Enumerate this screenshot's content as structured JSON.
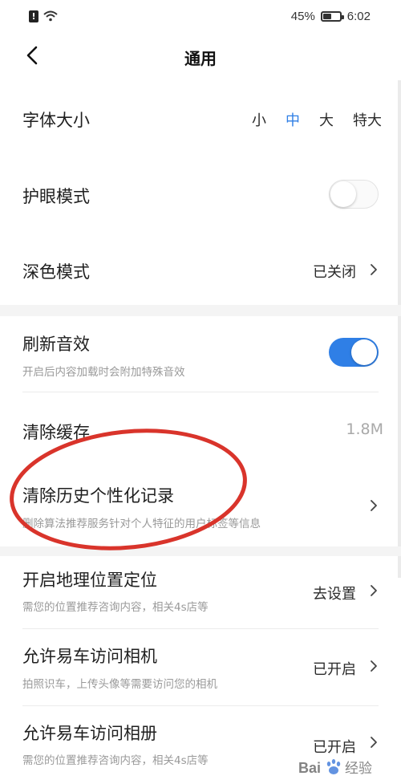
{
  "status_bar": {
    "battery": "45%",
    "battery_level": 0.45,
    "time": "6:02",
    "icons": [
      "alert-icon",
      "wifi-icon",
      "battery-icon"
    ]
  },
  "header": {
    "title": "通用",
    "back_icon": "chevron-left-icon"
  },
  "settings": {
    "font_size": {
      "label": "字体大小",
      "options": [
        "小",
        "中",
        "大",
        "特大"
      ],
      "selected": "中"
    },
    "eye_care": {
      "label": "护眼模式",
      "enabled": false
    },
    "dark_mode": {
      "label": "深色模式",
      "value": "已关闭"
    },
    "refresh_sound": {
      "label": "刷新音效",
      "description": "开启后内容加载时会附加特殊音效",
      "enabled": true
    },
    "clear_cache": {
      "label": "清除缓存",
      "value": "1.8M"
    },
    "clear_history": {
      "label": "清除历史个性化记录",
      "description": "删除算法推荐服务针对个人特征的用户标签等信息"
    },
    "location": {
      "label": "开启地理位置定位",
      "description": "需您的位置推荐咨询内容，相关4s店等",
      "value": "去设置"
    },
    "camera": {
      "label": "允许易车访问相机",
      "description": "拍照识车，上传头像等需要访问您的相机",
      "value": "已开启"
    },
    "album": {
      "label": "允许易车访问相册",
      "description": "需您的位置推荐咨询内容，相关4s店等",
      "value": "已开启"
    }
  },
  "colors": {
    "accent": "#2f7fe6",
    "annotation": "#d9342b",
    "secondary_text": "#9a9a9a"
  },
  "watermark": {
    "text": "Baidu 经验"
  }
}
